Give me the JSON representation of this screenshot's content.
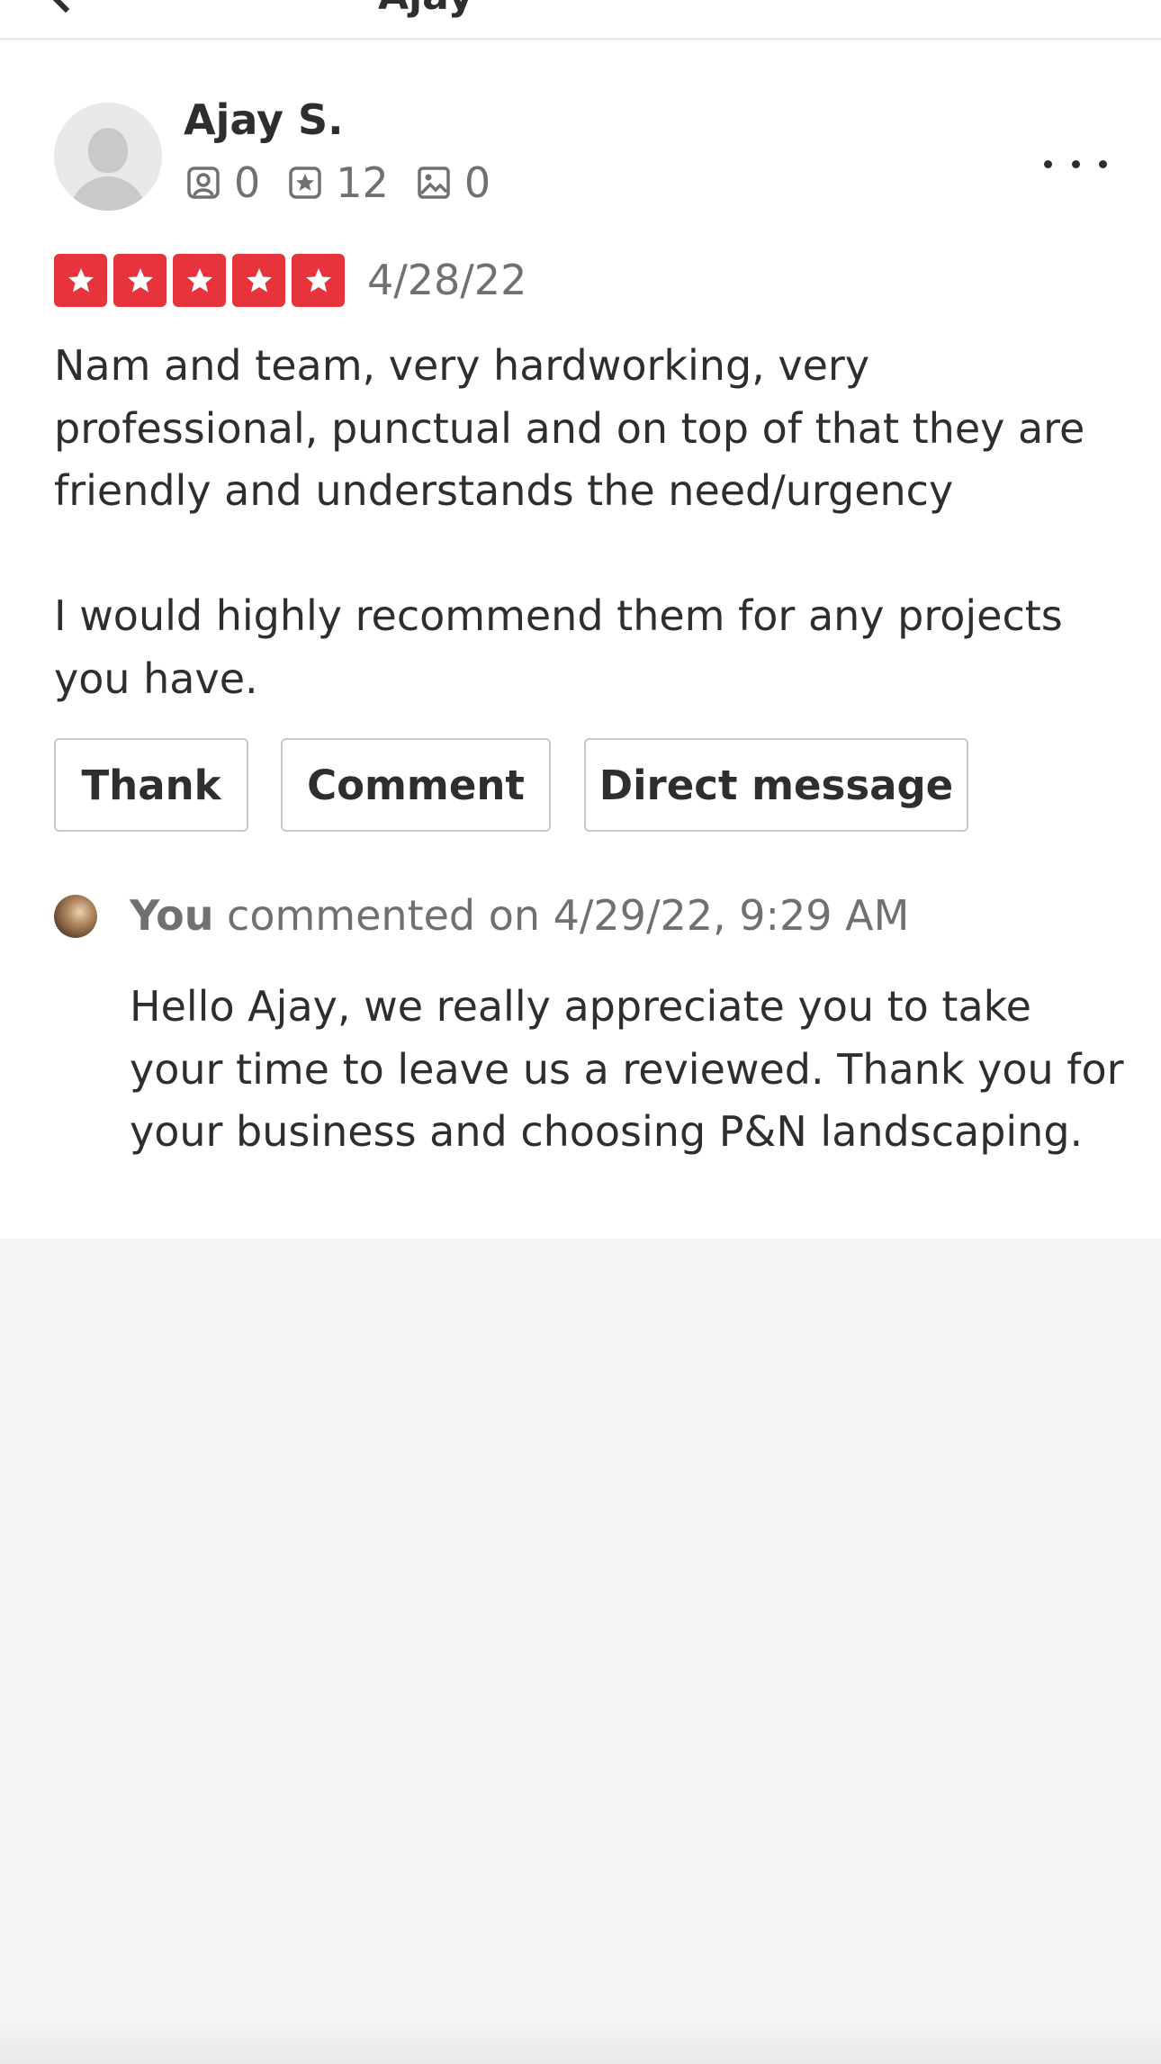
{
  "header": {
    "title_fragment": "Ajay"
  },
  "review": {
    "user": {
      "name": "Ajay S.",
      "friends_count": "0",
      "reviews_count": "12",
      "photos_count": "0"
    },
    "rating": 5,
    "rating_max": 5,
    "date": "4/28/22",
    "text": "Nam and team, very hardworking, very professional, punctual and on top of that they are friendly and understands the need/urgency\n\nI would highly recommend them for any projects you have.",
    "actions": {
      "thank_label": "Thank",
      "comment_label": "Comment",
      "direct_message_label": "Direct message"
    }
  },
  "owner_comment": {
    "author": "You",
    "meta": " commented on 4/29/22, 9:29 AM",
    "text": "Hello Ajay, we really appreciate you to take your time to leave us a reviewed. Thank you for your business and choosing P&N landscaping."
  },
  "colors": {
    "star_red": "#e7333b",
    "text_primary": "#2d2e2f",
    "text_secondary": "#6e7072",
    "page_background": "#f5f5f5"
  },
  "icons": {
    "friends": "friends-icon",
    "reviews": "reviews-star-icon",
    "photos": "photos-icon",
    "more": "more-options-icon"
  }
}
